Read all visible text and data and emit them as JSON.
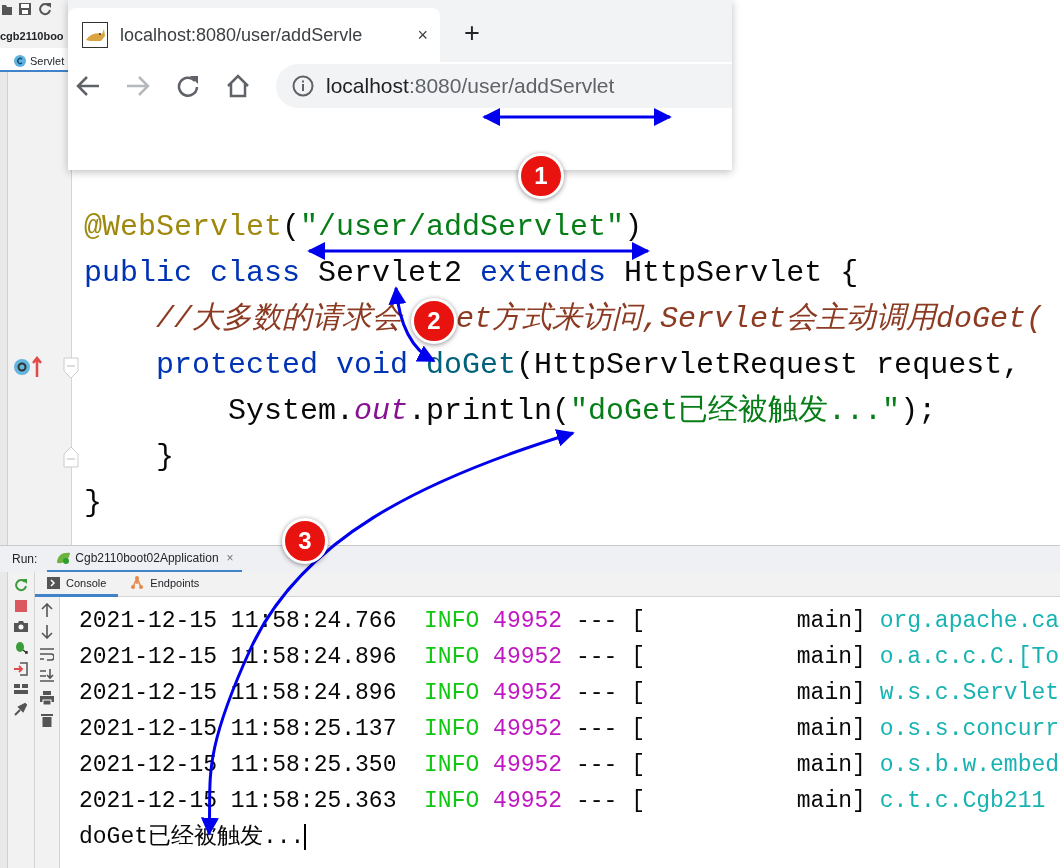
{
  "ide": {
    "project": "cgb2110boo",
    "file_tab": "Servlet"
  },
  "browser": {
    "tab_title": "localhost:8080/user/addServle",
    "tab_close": "×",
    "new_tab": "+",
    "url_host": "localhost",
    "url_path": ":8080/user/addServlet"
  },
  "code_lines": [
    {
      "tokens": [
        {
          "kind": "annotation",
          "text": "@WebServlet"
        },
        {
          "kind": "plain",
          "text": "("
        },
        {
          "kind": "string",
          "text": "\"/user/addServlet\""
        },
        {
          "kind": "plain",
          "text": ")"
        }
      ]
    },
    {
      "tokens": [
        {
          "kind": "keyword",
          "text": "public class"
        },
        {
          "kind": "plain",
          "text": " Servlet2 "
        },
        {
          "kind": "keyword",
          "text": "extends"
        },
        {
          "kind": "plain",
          "text": " HttpServlet {"
        }
      ],
      "children": [
        {
          "tokens": [
            {
              "kind": "comment",
              "text": "//大多数的请求会"
            },
            {
              "kind": "covered"
            },
            {
              "kind": "comment",
              "text": "et方式来访问,Servlet会主动调用doGet("
            }
          ]
        },
        {
          "tokens": [
            {
              "kind": "keyword",
              "text": "protected void"
            },
            {
              "kind": "method",
              "text": "doGet"
            },
            {
              "kind": "plain",
              "text": "(HttpServletRequest request,"
            }
          ],
          "children": [
            {
              "tokens": [
                {
                  "kind": "plain",
                  "text": "System."
                },
                {
                  "kind": "field",
                  "text": "out"
                },
                {
                  "kind": "plain",
                  "text": ".println("
                },
                {
                  "kind": "string",
                  "text": "\"doGet已经被触发...\""
                },
                {
                  "kind": "plain",
                  "text": ");"
                }
              ]
            }
          ]
        },
        {
          "tokens": [
            {
              "kind": "plain",
              "text": "}"
            }
          ]
        }
      ]
    },
    {
      "tokens": [
        {
          "kind": "plain",
          "text": "}"
        }
      ]
    }
  ],
  "run_panel": {
    "label": "Run:",
    "config_tab": {
      "label": "Cgb2110boot02Application",
      "close": "×"
    },
    "tabs": [
      {
        "label": "Console",
        "selected": true
      },
      {
        "label": "Endpoints",
        "selected": false
      }
    ]
  },
  "console": {
    "log_lines": [
      {
        "timestamp": "2021-12-15 11:58:24.766",
        "level": "INFO",
        "pid": "49952",
        "separator": "---",
        "bracket": "[",
        "thread": "main]",
        "logger": "org.apache.ca"
      },
      {
        "timestamp": "2021-12-15 11:58:24.896",
        "level": "INFO",
        "pid": "49952",
        "separator": "---",
        "bracket": "[",
        "thread": "main]",
        "logger": "o.a.c.c.C.[To"
      },
      {
        "timestamp": "2021-12-15 11:58:24.896",
        "level": "INFO",
        "pid": "49952",
        "separator": "---",
        "bracket": "[",
        "thread": "main]",
        "logger": "w.s.c.Servlet"
      },
      {
        "timestamp": "2021-12-15 11:58:25.137",
        "level": "INFO",
        "pid": "49952",
        "separator": "---",
        "bracket": "[",
        "thread": "main]",
        "logger": "o.s.s.concurr"
      },
      {
        "timestamp": "2021-12-15 11:58:25.350",
        "level": "INFO",
        "pid": "49952",
        "separator": "---",
        "bracket": "[",
        "thread": "main]",
        "logger": "o.s.b.w.embed"
      },
      {
        "timestamp": "2021-12-15 11:58:25.363",
        "level": "INFO",
        "pid": "49952",
        "separator": "---",
        "bracket": "[",
        "thread": "main]",
        "logger": "c.t.c.Cgb211"
      }
    ],
    "output": "doGet已经被触发..."
  },
  "annotations": [
    {
      "label": "1"
    },
    {
      "label": "2"
    },
    {
      "label": "3"
    }
  ]
}
